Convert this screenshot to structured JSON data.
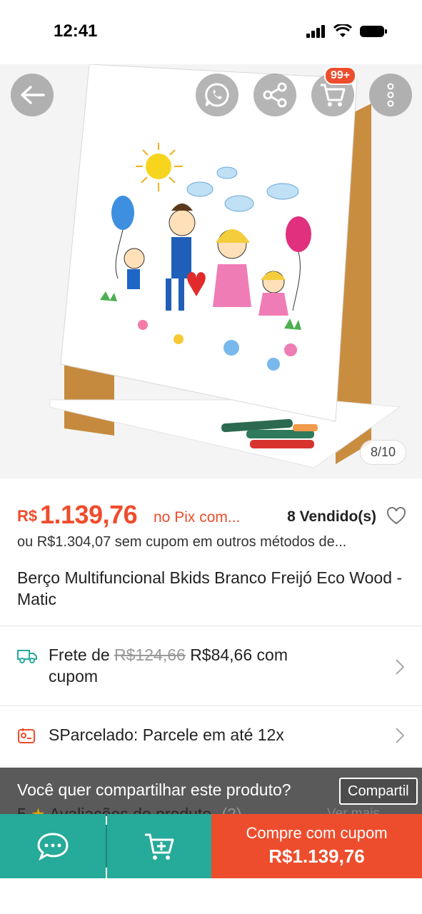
{
  "status_bar": {
    "time": "12:41"
  },
  "hero": {
    "image_counter": "8/10",
    "cart_badge": "99+"
  },
  "product": {
    "currency": "R$",
    "price": "1.139,76",
    "price_note": "no Pix com...",
    "sold": "8 Vendido(s)",
    "alt_price": "ou R$1.304,07 sem cupom em outros métodos de...",
    "title": "Berço Multifuncional Bkids Branco Freijó Eco Wood - Matic"
  },
  "shipping": {
    "prefix": "Frete de",
    "old_price": "R$124,66",
    "new_price": "R$84,66 com",
    "suffix": "cupom"
  },
  "installments": {
    "text": "SParcelado: Parcele em até 12x"
  },
  "share_banner": {
    "text": "Você quer compartilhar este produto?",
    "button": "Compartil"
  },
  "reviews": {
    "rating": "5",
    "label": "Avaliações do produto",
    "count": "(2)",
    "more": "Ver mais"
  },
  "bottom_bar": {
    "buy_label": "Compre com cupom",
    "buy_price": "R$1.139,76"
  },
  "colors": {
    "accent": "#ee4d2d",
    "teal": "#26aa99"
  },
  "icons": [
    "back-arrow-icon",
    "whatsapp-icon",
    "share-icon",
    "cart-icon",
    "more-icon",
    "heart-icon",
    "truck-icon",
    "installment-icon",
    "chevron-right-icon",
    "chat-icon",
    "add-to-cart-icon"
  ]
}
